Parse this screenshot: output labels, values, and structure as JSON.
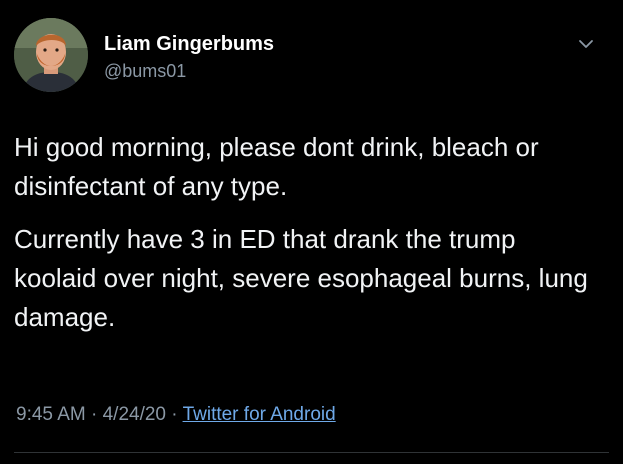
{
  "author": {
    "display_name": "Liam Gingerbums",
    "handle": "@bums01"
  },
  "tweet": {
    "paragraphs": [
      "Hi good morning, please dont drink, bleach or disinfectant of any type.",
      "Currently have 3 in ED that drank the trump koolaid over night, severe esophageal burns, lung damage."
    ]
  },
  "meta": {
    "time": "9:45 AM",
    "separator": "·",
    "date": "4/24/20",
    "source": "Twitter for Android"
  },
  "icons": {
    "avatar": "avatar",
    "menu": "chevron-down-icon"
  },
  "colors": {
    "background": "#000000",
    "text": "#f1f3f5",
    "secondary": "#8b98a5",
    "link": "#6fa9e8"
  }
}
